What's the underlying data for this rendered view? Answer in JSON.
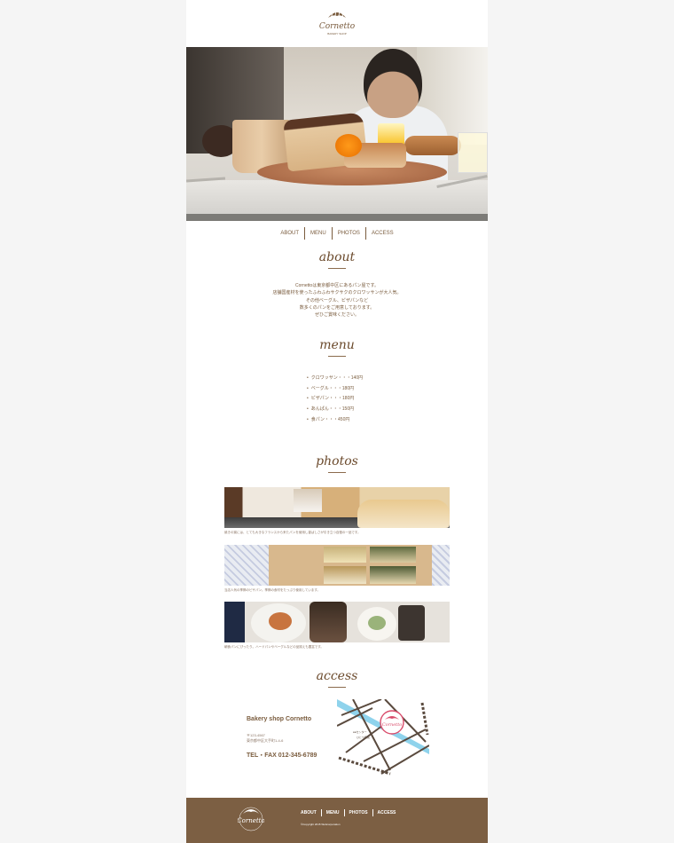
{
  "header": {
    "logo_text": "Cornetto",
    "logo_sub": "BAKERY SHOP"
  },
  "nav": {
    "items": [
      "ABOUT",
      "MENU",
      "PHOTOS",
      "ACCESS"
    ]
  },
  "about": {
    "title": "about",
    "lines": [
      "Cornettoは東京都中区にあるパン屋です。",
      "店舗国産材を使ったふわふわサクサクのクロワッサンが大人気。",
      "その他ベーグル、ピザパンなど",
      "数多くのパンをご用意しております。",
      "ぜひご賞味ください。"
    ]
  },
  "menu": {
    "title": "menu",
    "items": [
      "クロワッサン・・・140円",
      "ベーグル・・・180円",
      "ピザパン・・・180円",
      "あんぱん・・・150円",
      "食パン・・・450円"
    ]
  },
  "photos": {
    "title": "photos",
    "captions": [
      "焼きの窯には、とても大きなフランスから来たパンを使用し香ばしさが引き立つ自慢の一品です。",
      "当店人気の季節のピザパン。季節の食材をたっぷり使用しています。",
      "朝食パンにぴったり。ハードパンやベーグルなどの品揃えも豊富です。"
    ]
  },
  "access": {
    "title": "access",
    "shop_name": "Bakery shop Cornetto",
    "postal": "〒123-4567",
    "address": "東京都中区大手町1-4-6",
    "tel": "TEL・FAX 012-345-6789",
    "map_label_1": "●●センター",
    "map_label_2": "ひとつ病院"
  },
  "footer": {
    "logo_text": "Cornetto",
    "nav": [
      "ABOUT",
      "MENU",
      "PHOTOS",
      "ACCESS"
    ],
    "copyright": "©Copyright 2015 Webcorporation"
  },
  "colors": {
    "brand": "#7a5c3e",
    "footer_bg": "#7c5f43",
    "page_bg": "#f5f5f5",
    "river": "#8fd3ec"
  }
}
